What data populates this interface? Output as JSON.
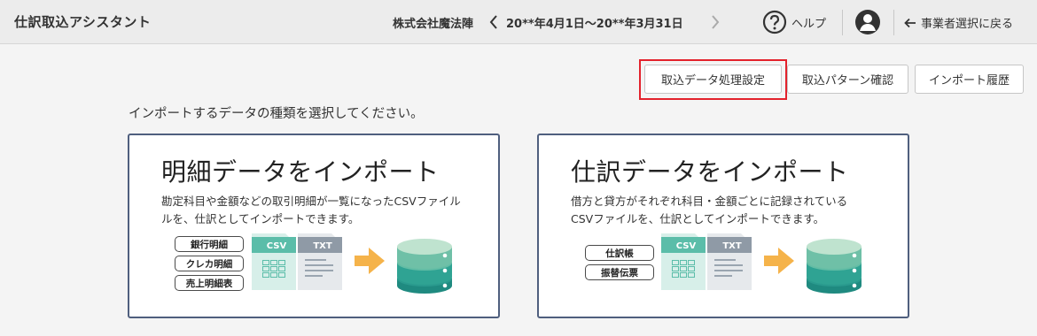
{
  "header": {
    "app_title": "仕訳取込アシスタント",
    "company": "株式会社魔法陣",
    "period": "20**年4月1日〜20**年3月31日",
    "prev_icon": "chevron-left-icon",
    "next_icon": "chevron-right-icon",
    "help_icon": "question-circle-icon",
    "help_label": "ヘルプ",
    "user_icon": "user-avatar-icon",
    "back_icon": "arrow-left-icon",
    "back_label": "事業者選択に戻る"
  },
  "toolbar": {
    "settings_label": "取込データ処理設定",
    "pattern_label": "取込パターン確認",
    "history_label": "インポート履歴",
    "highlight_color": "#e3222c"
  },
  "main": {
    "instruction": "インポートするデータの種類を選択してください。"
  },
  "cards": [
    {
      "title": "明細データをインポート",
      "desc_line1": "勘定科目や金額などの取引明細が一覧になったCSVファイル",
      "desc_line2": "ルを、仕訳としてインポートできます。",
      "tags": [
        "銀行明細",
        "クレカ明細",
        "売上明細表"
      ],
      "csv_label": "CSV",
      "txt_label": "TXT"
    },
    {
      "title": "仕訳データをインポート",
      "desc_line1": "借方と貸方がそれぞれ科目・金額ごとに記録されている",
      "desc_line2": "CSVファイルを、仕訳としてインポートできます。",
      "tags": [
        "仕訳帳",
        "振替伝票"
      ],
      "csv_label": "CSV",
      "txt_label": "TXT"
    }
  ],
  "colors": {
    "card_border": "#4f5f7e",
    "csv_green": "#5bbda9",
    "txt_gray": "#8f9aa6",
    "arrow_orange": "#f5b34a",
    "db_teal": "#2a9a8e"
  }
}
